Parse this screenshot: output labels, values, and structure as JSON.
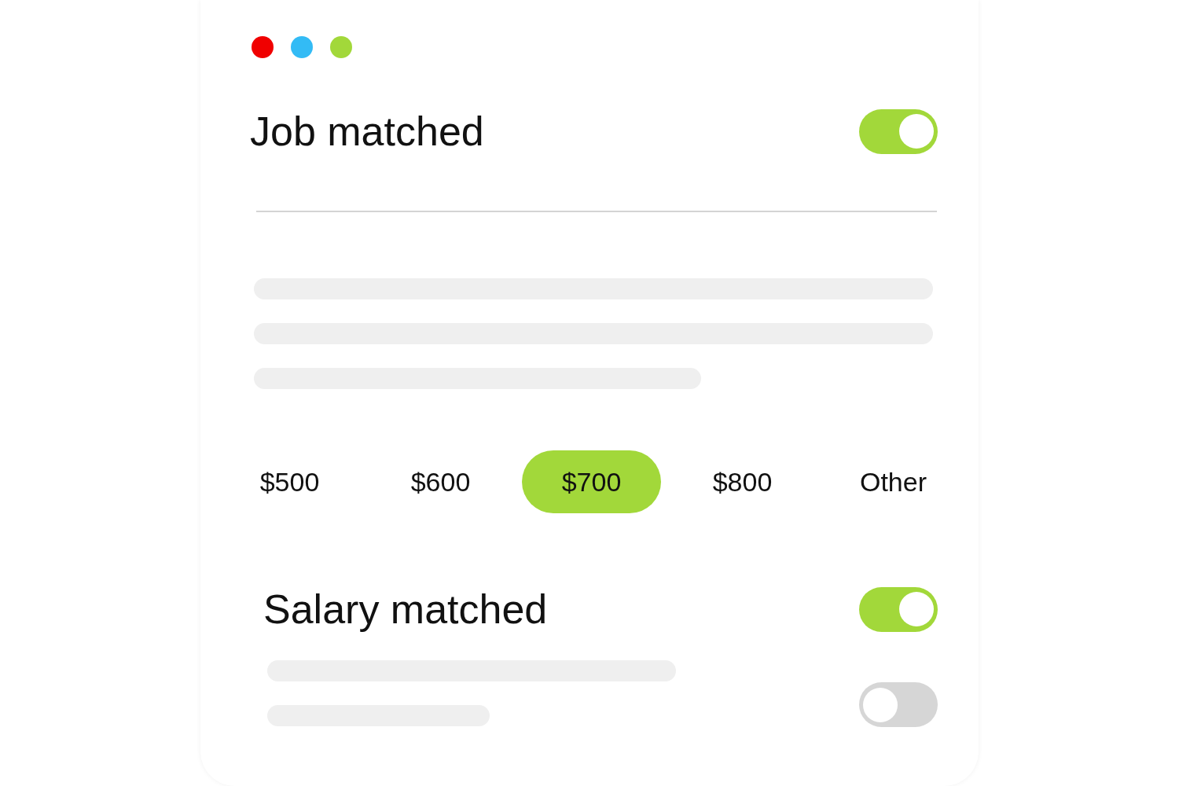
{
  "window_dots": [
    {
      "color": "#f00000"
    },
    {
      "color": "#33bbf5"
    },
    {
      "color": "#a2d83a"
    }
  ],
  "job_section": {
    "title": "Job matched",
    "on": true
  },
  "amount_options": [
    {
      "label": "$500",
      "selected": false
    },
    {
      "label": "$600",
      "selected": false
    },
    {
      "label": "$700",
      "selected": true
    },
    {
      "label": "$800",
      "selected": false
    },
    {
      "label": "Other",
      "selected": false
    }
  ],
  "salary_section": {
    "title": "Salary matched",
    "on": true
  },
  "extra_toggle": {
    "on": false
  }
}
